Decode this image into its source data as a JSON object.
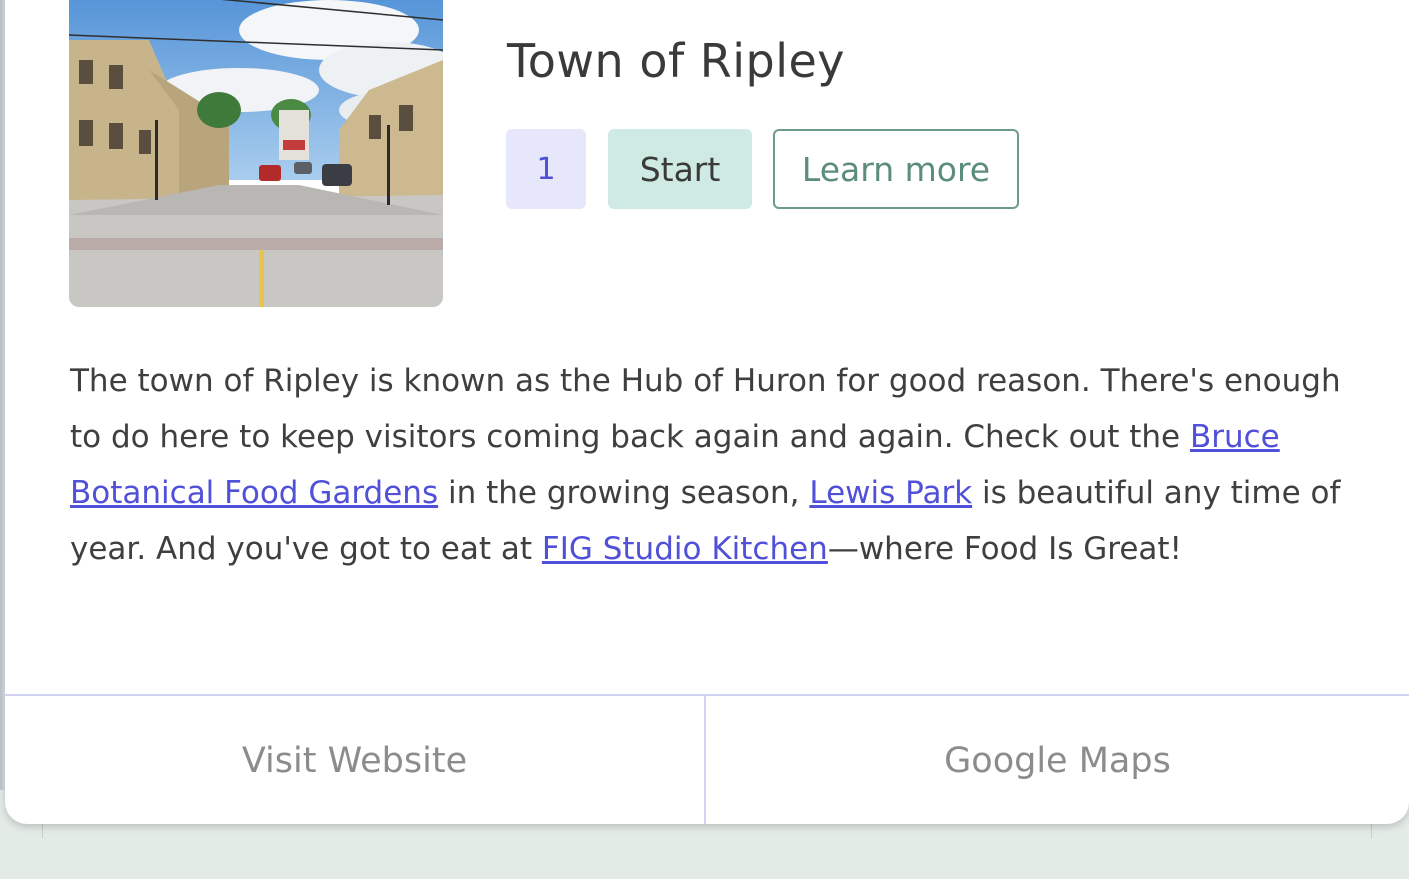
{
  "card": {
    "title": "Town of Ripley",
    "badge_number": "1",
    "start_label": "Start",
    "learn_more_label": "Learn more",
    "description": {
      "part1": "The town of Ripley is known as the Hub of Huron for good reason. There's enough to do here to keep visitors coming back again and again. Check out the ",
      "link1": "Bruce Botanical Food Gardens",
      "part2": " in the growing season, ",
      "link2": "Lewis Park",
      "part3": " is beautiful any time of year. And you've got to eat at ",
      "link3": "FIG Studio Kitchen",
      "part4": "—where Food Is Great!"
    },
    "footer": {
      "website_label": "Visit Website",
      "maps_label": "Google Maps"
    }
  },
  "colors": {
    "badge_bg": "#e7e7fb",
    "badge_text": "#4e4ed6",
    "start_bg": "#cfeae2",
    "learn_border": "#6c9b8e",
    "link": "#5050d8",
    "footer_border": "#d2d2f4"
  }
}
